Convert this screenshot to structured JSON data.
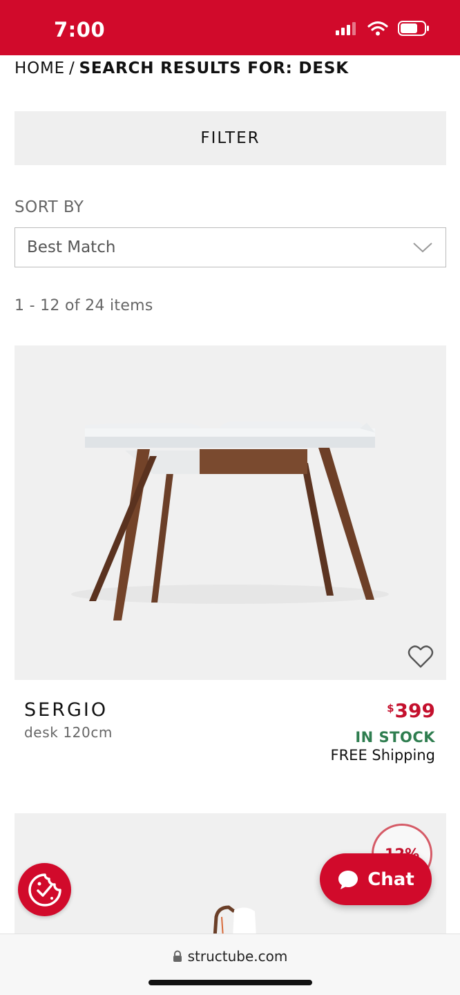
{
  "status": {
    "time": "7:00"
  },
  "breadcrumb": {
    "home": "HOME",
    "separator": "/",
    "current": "SEARCH RESULTS FOR: DESK"
  },
  "filter": {
    "label": "FILTER"
  },
  "sort": {
    "label": "SORT BY",
    "selected": "Best Match"
  },
  "results": {
    "count_text": "1 - 12 of 24 items"
  },
  "products": [
    {
      "name": "SERGIO",
      "description": "desk 120cm",
      "price_currency": "$",
      "price_amount": "399",
      "stock": "IN STOCK",
      "shipping": "FREE Shipping"
    },
    {
      "discount": "12%"
    }
  ],
  "chat": {
    "label": "Chat"
  },
  "browser": {
    "url": "structube.com"
  },
  "colors": {
    "brand": "#d10a2b",
    "price": "#c4102d",
    "stock": "#2e7d4f"
  },
  "icons": [
    "signal-icon",
    "wifi-icon",
    "battery-icon",
    "chevron-down-icon",
    "heart-icon",
    "cookie-icon",
    "chat-bubble-icon",
    "lock-icon"
  ]
}
